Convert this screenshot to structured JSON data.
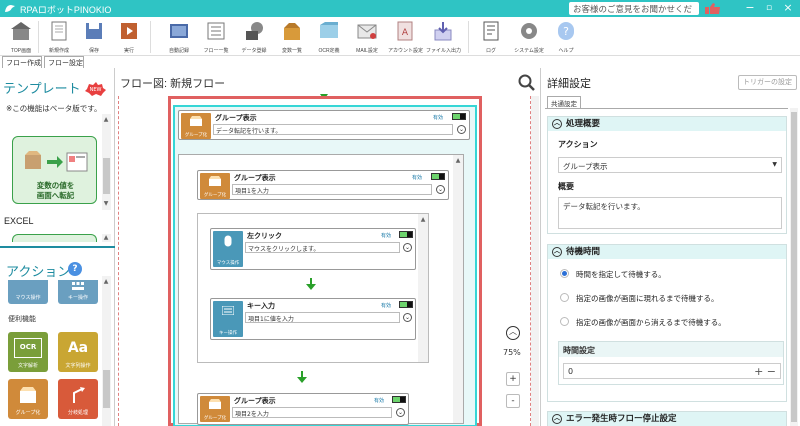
{
  "titlebar": {
    "app_title": "RPAロボットPINOKIO",
    "feedback": "お客様のご意見をお聞かせください"
  },
  "toolbar": [
    {
      "label": "TOP画面"
    },
    {
      "label": "新規作成"
    },
    {
      "label": "保存"
    },
    {
      "label": "実行"
    },
    {
      "label": "自動記録"
    },
    {
      "label": "フロー一覧"
    },
    {
      "label": "データ登録"
    },
    {
      "label": "変数一覧"
    },
    {
      "label": "OCR定義"
    },
    {
      "label": "MAIL設定"
    },
    {
      "label": "アカウント設定"
    },
    {
      "label": "ファイル入出力"
    },
    {
      "label": "ログ"
    },
    {
      "label": "システム設定"
    },
    {
      "label": "ヘルプ"
    }
  ],
  "tabs": {
    "flow_create": "フロー作成",
    "flow_settings": "フロー設定"
  },
  "left": {
    "template_header": "テンプレート",
    "new_badge": "NEW",
    "beta_note": "※この機能はベータ版です。",
    "template_card_line1": "変数の値を",
    "template_card_line2": "画面へ転記",
    "excel_label": "EXCEL",
    "action_header": "アクション",
    "help_glyph": "?",
    "mouse_label": "マウス操作",
    "keyboard_label": "キー操作",
    "convenience_label": "便利機能",
    "ocr_label": "文字解析",
    "ocr_glyph": "OCR",
    "text_label": "文字列操作",
    "text_glyph": "Aa",
    "group_label": "グループ化",
    "branch_label": "分岐処理"
  },
  "canvas": {
    "title": "フロー図:  新規フロー",
    "zoom": "75%",
    "zoom_in": "+",
    "zoom_out": "-",
    "enabled": "有効",
    "blocks": {
      "g1_title": "グループ表示",
      "g1_desc": "データ転記を行います。",
      "g1_icon": "グループ化",
      "g2_title": "グループ表示",
      "g2_desc": "項目1を入力",
      "g2_icon": "グループ化",
      "click_title": "左クリック",
      "click_desc": "マウスをクリックします。",
      "click_icon": "マウス操作",
      "key_title": "キー入力",
      "key_desc": "項目1に値を入力",
      "key_icon": "キー操作",
      "g3_title": "グループ表示",
      "g3_desc": "項目2を入力",
      "g3_icon": "グループ化"
    }
  },
  "right": {
    "title": "詳細設定",
    "trigger_button": "トリガーの設定",
    "tab_common": "共通設定",
    "process_header": "処理概要",
    "action_label": "アクション",
    "action_value": "グループ表示",
    "summary_label": "概要",
    "summary_value": "データ転記を行います。",
    "wait_header": "待機時間",
    "wait_opt1": "時間を指定して待機する。",
    "wait_opt2": "指定の画像が画面に現れるまで待機する。",
    "wait_opt3": "指定の画像が画面から消えるまで待機する。",
    "time_setting_label": "時間設定",
    "time_value": "0",
    "time_controls": "+ −",
    "error_header": "エラー発生時フロー停止設定"
  }
}
